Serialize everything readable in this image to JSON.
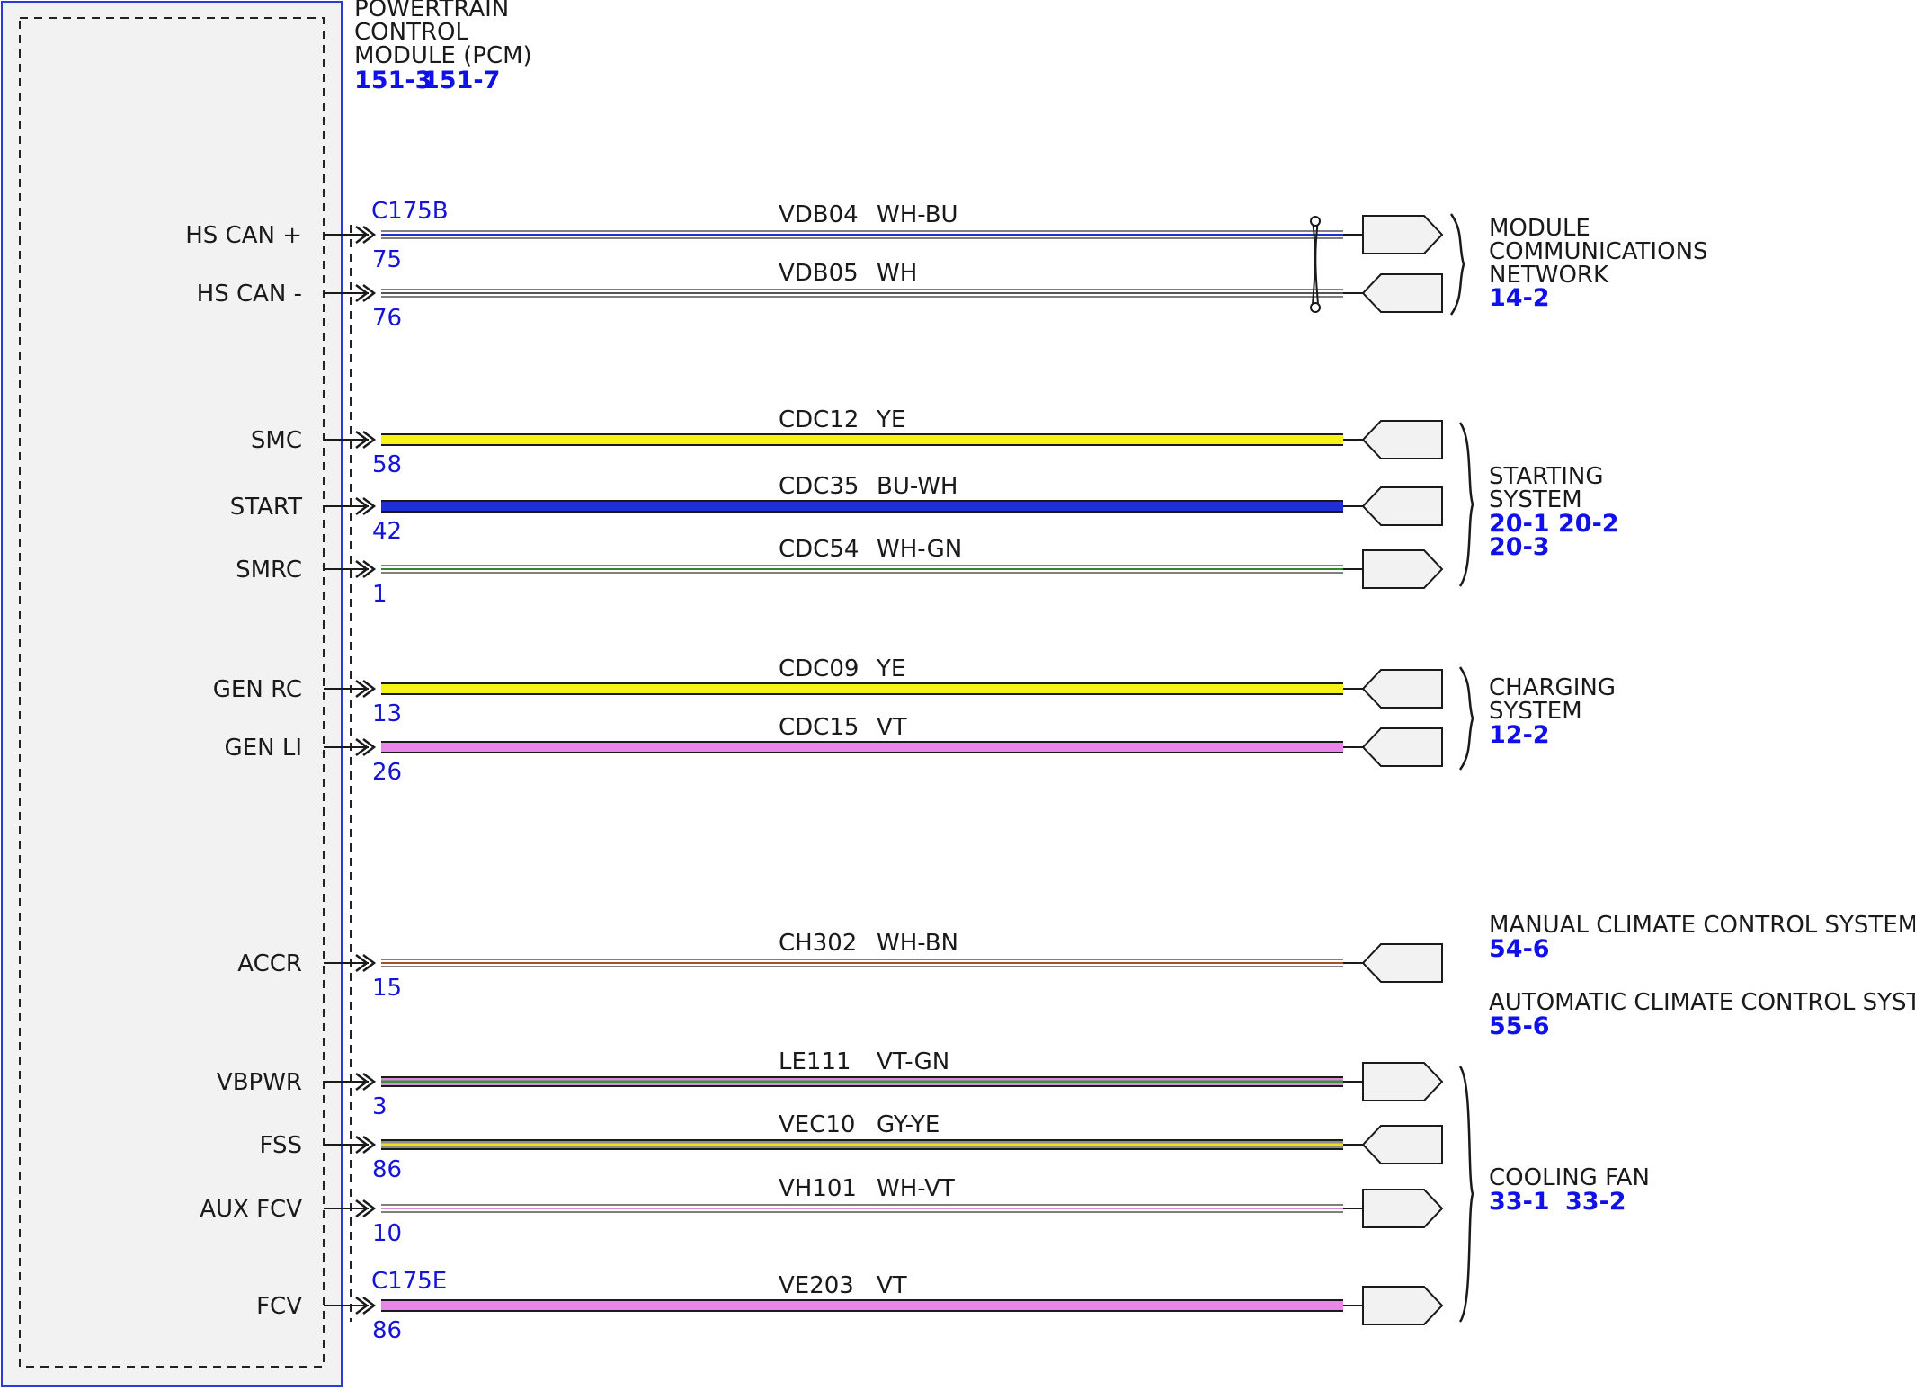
{
  "module": {
    "title_lines": [
      "POWERTRAIN",
      "CONTROL",
      "MODULE (PCM)"
    ],
    "refs": [
      "151-3",
      "151-7"
    ]
  },
  "connectors": [
    "C175B",
    "C175E"
  ],
  "circuits": [
    {
      "pin_label": "HS CAN +",
      "pin": "75",
      "circuit": "VDB04",
      "color_code": "WH-BU",
      "wire_colors": [
        "#ffffff",
        "#1f2fd6"
      ],
      "connector": "C175B",
      "direction": "out"
    },
    {
      "pin_label": "HS CAN -",
      "pin": "76",
      "circuit": "VDB05",
      "color_code": "WH",
      "wire_colors": [
        "#ffffff"
      ],
      "direction": "in"
    },
    {
      "pin_label": "SMC",
      "pin": "58",
      "circuit": "CDC12",
      "color_code": "YE",
      "wire_colors": [
        "#f7f21a"
      ],
      "direction": "in"
    },
    {
      "pin_label": "START",
      "pin": "42",
      "circuit": "CDC35",
      "color_code": "BU-WH",
      "wire_colors": [
        "#1f2fd6",
        "#1f2fd6"
      ],
      "direction": "in"
    },
    {
      "pin_label": "SMRC",
      "pin": "1",
      "circuit": "CDC54",
      "color_code": "WH-GN",
      "wire_colors": [
        "#ffffff",
        "#2e8b2e"
      ],
      "direction": "out"
    },
    {
      "pin_label": "GEN RC",
      "pin": "13",
      "circuit": "CDC09",
      "color_code": "YE",
      "wire_colors": [
        "#f7f21a"
      ],
      "direction": "in"
    },
    {
      "pin_label": "GEN LI",
      "pin": "26",
      "circuit": "CDC15",
      "color_code": "VT",
      "wire_colors": [
        "#ea86ea"
      ],
      "direction": "in"
    },
    {
      "pin_label": "ACCR",
      "pin": "15",
      "circuit": "CH302",
      "color_code": "WH-BN",
      "wire_colors": [
        "#ffffff",
        "#a0522d"
      ],
      "direction": "in"
    },
    {
      "pin_label": "VBPWR",
      "pin": "3",
      "circuit": "LE111",
      "color_code": "VT-GN",
      "wire_colors": [
        "#d98bd9",
        "#3f8f3f"
      ],
      "direction": "out"
    },
    {
      "pin_label": "FSS",
      "pin": "86",
      "circuit": "VEC10",
      "color_code": "GY-YE",
      "wire_colors": [
        "#8c8c8c",
        "#e8e020"
      ],
      "direction": "in"
    },
    {
      "pin_label": "AUX FCV",
      "pin": "10",
      "circuit": "VH101",
      "color_code": "WH-VT",
      "wire_colors": [
        "#ffffff",
        "#d98bd9"
      ],
      "direction": "out"
    },
    {
      "pin_label": "FCV",
      "pin": "86",
      "circuit": "VE203",
      "color_code": "VT",
      "wire_colors": [
        "#ea86ea"
      ],
      "connector": "C175E",
      "direction": "out"
    }
  ],
  "systems": [
    {
      "name_lines": [
        "MODULE",
        "COMMUNICATIONS",
        "NETWORK"
      ],
      "refs": [
        [
          "14-2"
        ]
      ]
    },
    {
      "name_lines": [
        "STARTING",
        "SYSTEM"
      ],
      "refs": [
        [
          "20-1",
          "20-2"
        ],
        [
          "20-3"
        ]
      ]
    },
    {
      "name_lines": [
        "CHARGING",
        "SYSTEM"
      ],
      "refs": [
        [
          "12-2"
        ]
      ]
    },
    {
      "name_lines": [
        "MANUAL CLIMATE CONTROL SYSTEM"
      ],
      "refs": [
        [
          "54-6"
        ]
      ]
    },
    {
      "name_lines": [
        "AUTOMATIC CLIMATE CONTROL SYSTEM"
      ],
      "refs": [
        [
          "55-6"
        ]
      ]
    },
    {
      "name_lines": [
        "COOLING FAN"
      ],
      "refs": [
        [
          "33-1",
          "33-2"
        ]
      ]
    }
  ],
  "colors": {
    "wire_outline": "#1a1a1a",
    "module_border": "#2a3bd6",
    "module_fill": "#f2f2f2",
    "reference_blue": "#1010e8",
    "pin_blue": "#1414d6",
    "terminal_fill": "#f2f2f2"
  },
  "icons": [
    "pin-arrow-icon",
    "twisted-pair-icon",
    "terminal-arrow-icon",
    "brace-icon"
  ]
}
